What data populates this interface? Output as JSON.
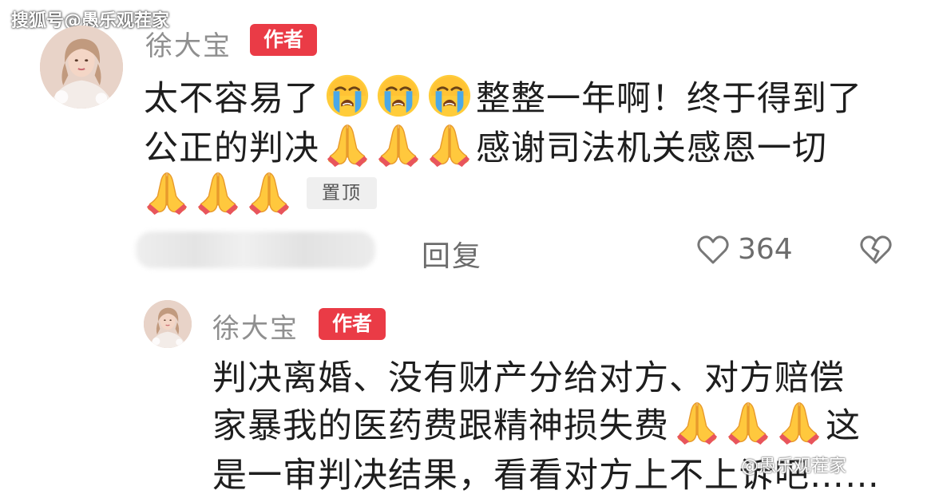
{
  "watermarks": {
    "top": "搜狐号@愚乐观茬家",
    "bottom": "@愚乐观茬家"
  },
  "comment": {
    "username": "徐大宝",
    "badge": "作者",
    "line1_a": "太不容易了",
    "line1_b": "整整一年啊！终于得到了",
    "line2_a": "公正的判决",
    "line2_b": "感谢司法机关感恩一切",
    "pinned_label": "置顶",
    "reply_label": "回复",
    "like_count": "364"
  },
  "reply": {
    "username": "徐大宝",
    "badge": "作者",
    "line1": "判决离婚、没有财产分给对方、对方赔偿",
    "line2": "家暴我的医药费跟精神损失费",
    "line2_end": "这",
    "line3": "是一审判决结果，看看对方上不上诉吧……"
  },
  "icons": {
    "crying": "loudly-crying-face-emoji",
    "pray": "folded-hands-emoji",
    "heart": "heart-outline-icon",
    "broken_heart": "broken-heart-outline-icon"
  },
  "colors": {
    "badge_red": "#ea3b46",
    "muted_text": "#8f8f8f",
    "body_text": "#1e1e1e"
  }
}
